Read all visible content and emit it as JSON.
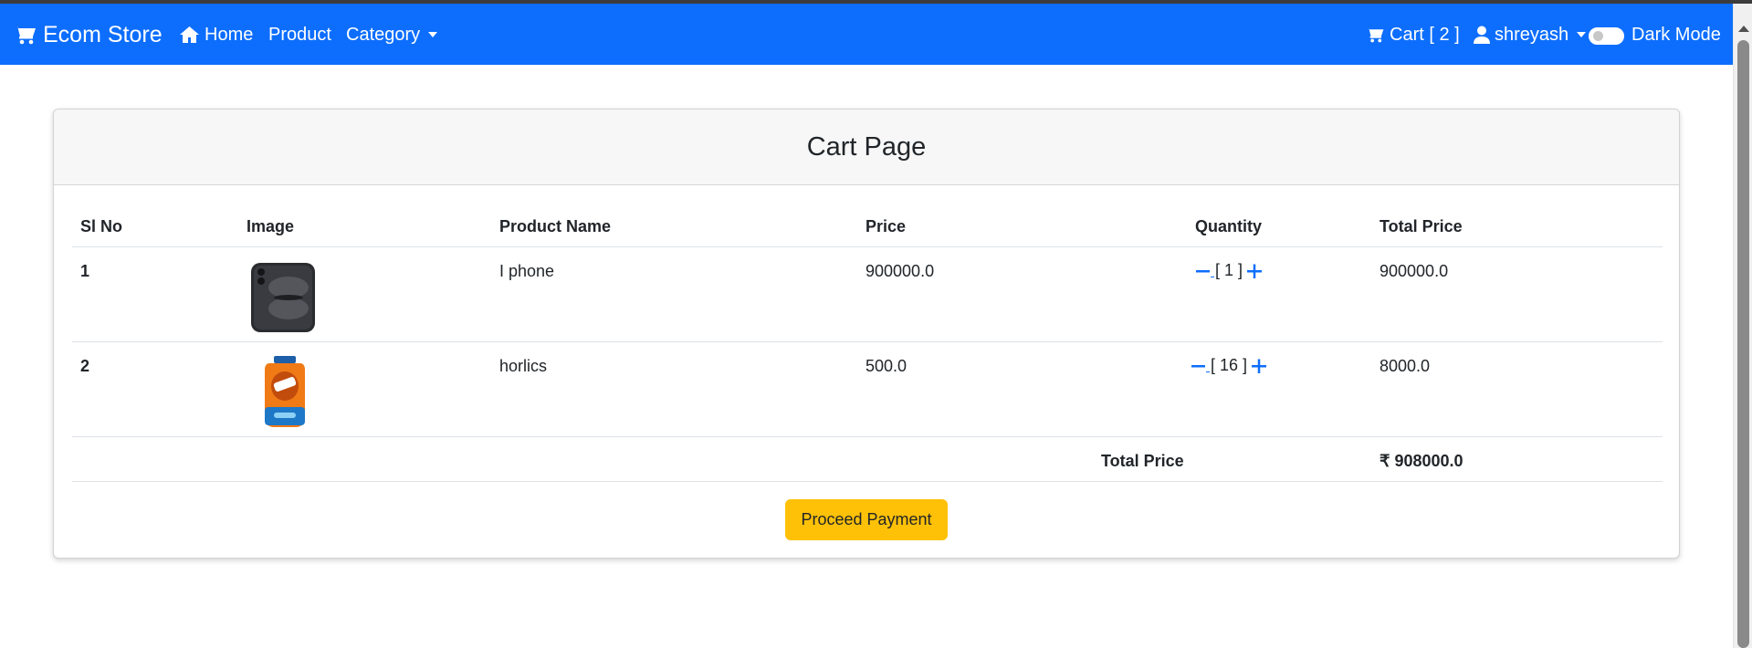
{
  "navbar": {
    "brand": "Ecom Store",
    "items": [
      {
        "label": "Home",
        "icon": "home-icon"
      },
      {
        "label": "Product"
      },
      {
        "label": "Category",
        "dropdown": true
      }
    ],
    "cart_label": "Cart [ 2 ]",
    "user_name": "shreyash",
    "dark_mode_label": "Dark Mode",
    "dark_mode_on": false,
    "color": "#0d6efd"
  },
  "card": {
    "title": "Cart Page"
  },
  "table": {
    "headers": [
      "Sl No",
      "Image",
      "Product Name",
      "Price",
      "Quantity",
      "Total Price"
    ],
    "rows": [
      {
        "sl": "1",
        "image": "iphone-image",
        "name": "I phone",
        "price": "900000.0",
        "qty": "[ 1 ]",
        "total": "900000.0"
      },
      {
        "sl": "2",
        "image": "horlics-jar-image",
        "name": "horlics",
        "price": "500.0",
        "qty": "[ 16 ]",
        "total": "8000.0"
      }
    ],
    "footer_label": "Total Price",
    "grand_total": "₹ 908000.0"
  },
  "actions": {
    "proceed_label": "Proceed Payment",
    "button_color": "#ffc107"
  }
}
